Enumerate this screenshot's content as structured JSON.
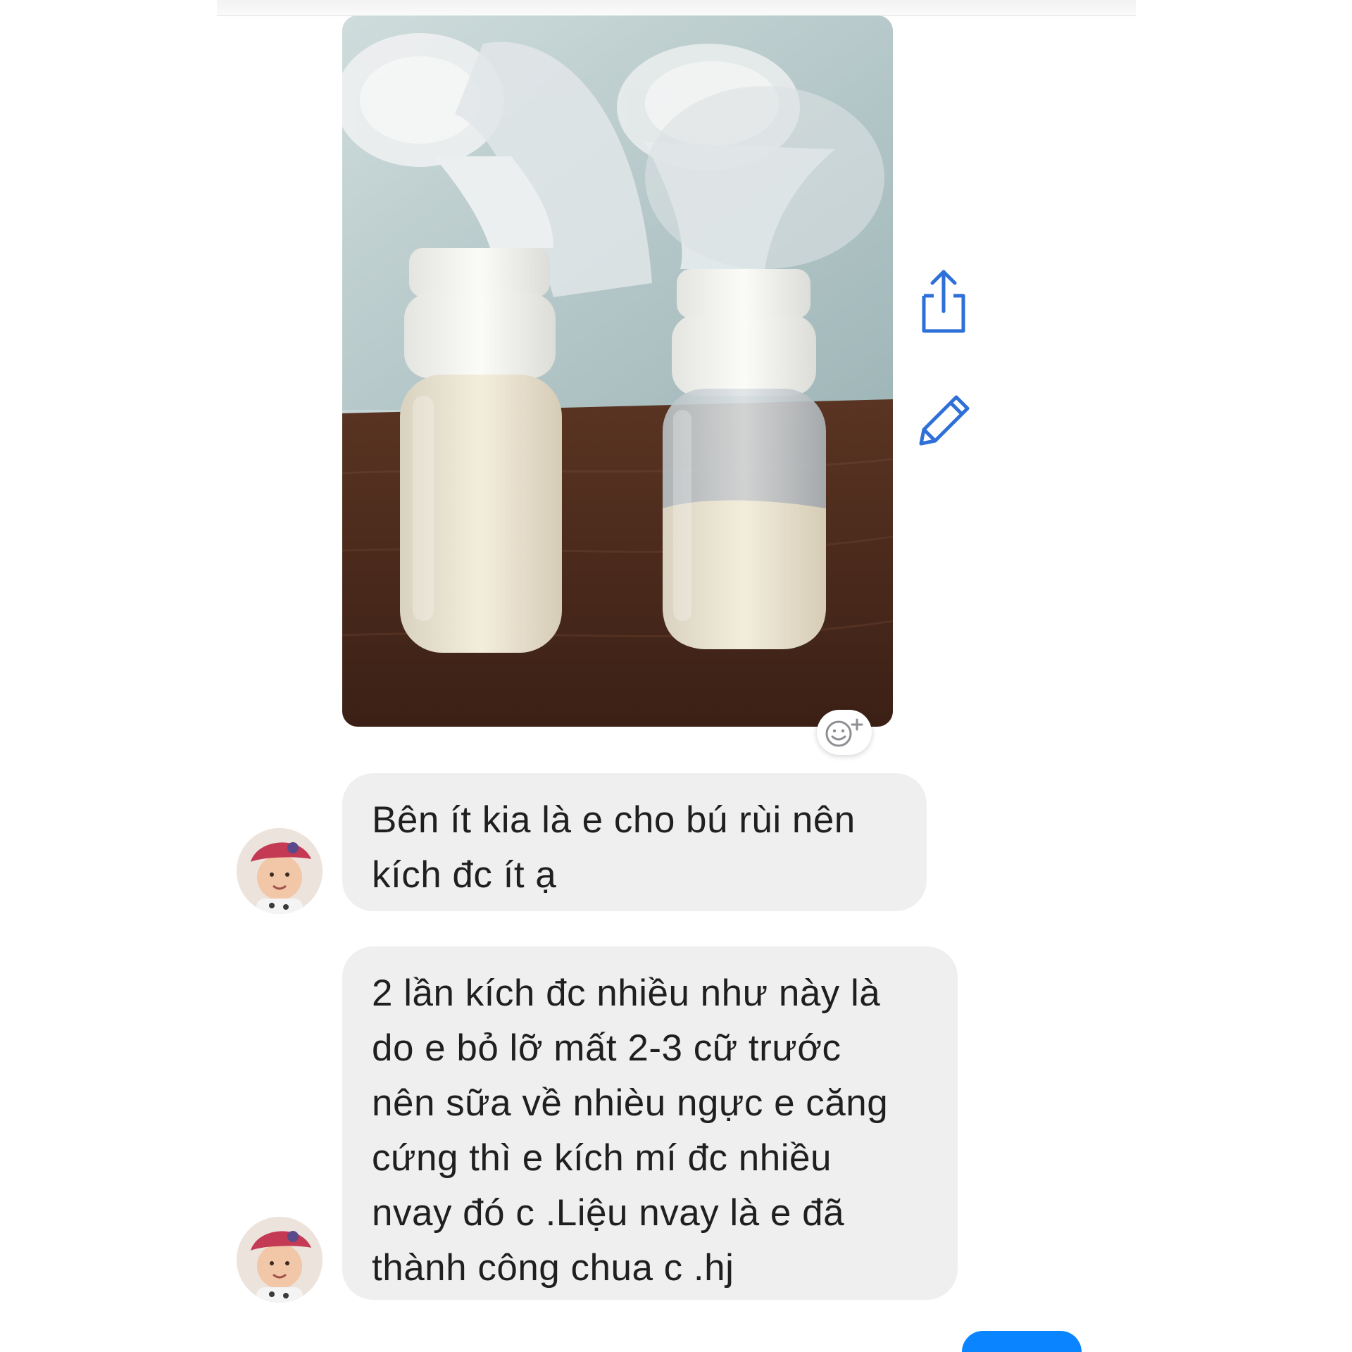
{
  "conversation": {
    "photo_message": {
      "description_icon": "photo-two-milk-bottles"
    },
    "actions": {
      "share_icon": "share-icon",
      "edit_icon": "pencil-icon",
      "reaction_icon": "add-reaction-icon",
      "reaction_plus": "+"
    },
    "messages": [
      {
        "lines": [
          "Bên ít kia là e cho bú rùi nên",
          "kích đc ít ạ"
        ]
      },
      {
        "lines": [
          "2 lần kích đc nhiều như này là",
          "do e bỏ lỡ mất 2-3 cữ trước",
          "nên sữa về nhièu ngực e căng",
          "cứng thì e kích mí đc nhiều",
          "nvay đó c .Liệu nvay là e đã",
          "thành công chua c .hj"
        ]
      }
    ]
  },
  "colors": {
    "bubble_bg": "#efefef",
    "text": "#1f1f1f",
    "icon_blue": "#2f6fd8",
    "accent_blue": "#0a84ff"
  }
}
